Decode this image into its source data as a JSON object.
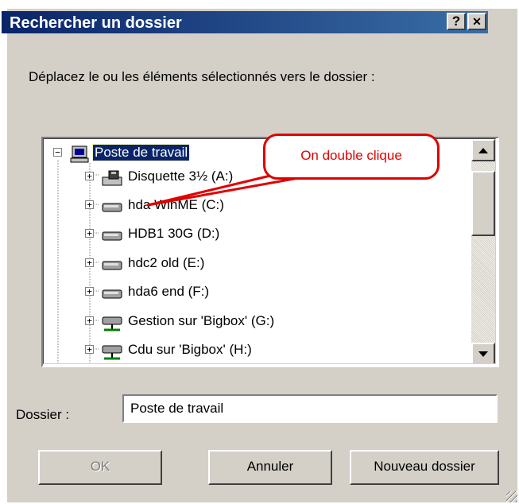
{
  "window": {
    "title": "Rechercher un dossier",
    "help_button": "?",
    "close_button": "✕"
  },
  "instruction": "Déplacez le ou les  éléments sélectionnés vers le dossier :",
  "tree": {
    "root_label": "Poste de travail",
    "items": [
      {
        "label": "Disquette 3½ (A:)",
        "icon": "floppy-drive-icon"
      },
      {
        "label": "hda WinME (C:)",
        "icon": "hard-drive-icon"
      },
      {
        "label": "HDB1 30G (D:)",
        "icon": "hard-drive-icon"
      },
      {
        "label": "hdc2 old (E:)",
        "icon": "hard-drive-icon"
      },
      {
        "label": "hda6 end (F:)",
        "icon": "hard-drive-icon"
      },
      {
        "label": "Gestion sur 'Bigbox' (G:)",
        "icon": "network-drive-icon"
      },
      {
        "label": "Cdu sur 'Bigbox' (H:)",
        "icon": "network-drive-icon"
      }
    ]
  },
  "callout": {
    "text": "On double clique",
    "color": "#e00000"
  },
  "folder": {
    "label": "Dossier :",
    "value": "Poste de travail"
  },
  "buttons": {
    "ok": "OK",
    "cancel": "Annuler",
    "new_folder": "Nouveau dossier"
  },
  "colors": {
    "titlebar": "#0a246a",
    "face": "#d4d0c8",
    "selection": "#0a246a"
  }
}
